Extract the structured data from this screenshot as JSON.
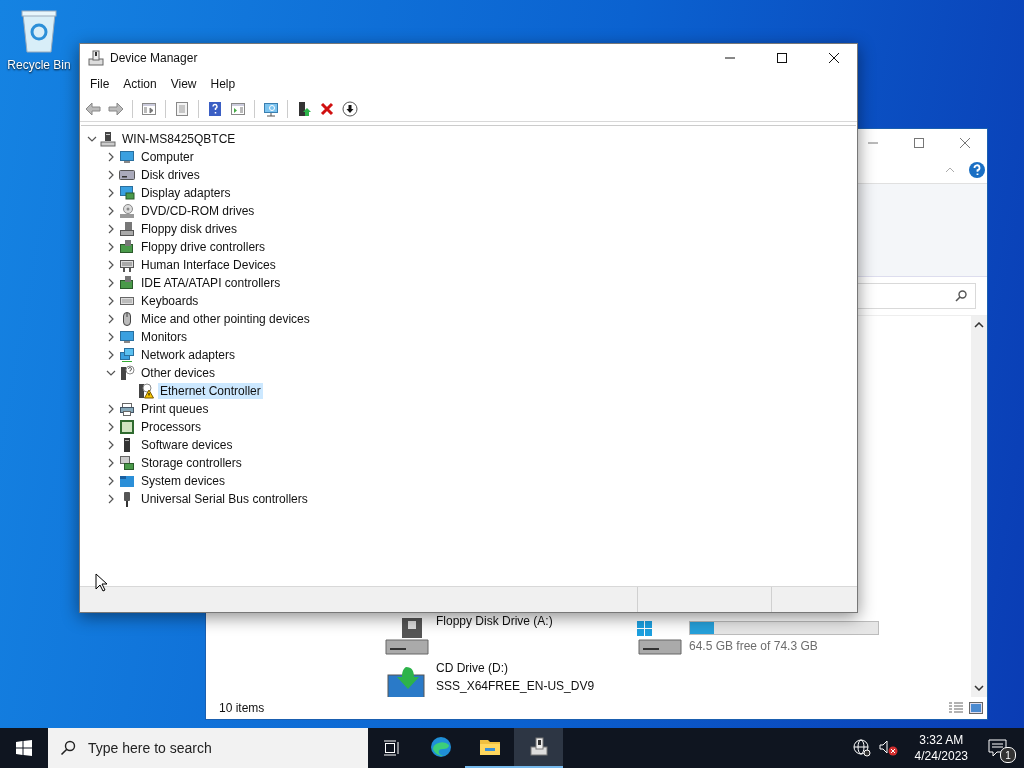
{
  "desktop_icons": [
    {
      "label": "Recycle Bin"
    }
  ],
  "explorer": {
    "items": [
      {
        "kind": "floppy",
        "name": "Floppy Disk Drive (A:)"
      },
      {
        "kind": "disk",
        "level": 0.13,
        "detail": "64.5 GB free of 74.3 GB"
      },
      {
        "kind": "cd",
        "name": "CD Drive (D:)",
        "detail": "SSS_X64FREE_EN-US_DV9"
      }
    ],
    "status": "10 items"
  },
  "window": {
    "title": "Device Manager",
    "menu": [
      "File",
      "Action",
      "View",
      "Help"
    ],
    "tree": {
      "label": "WIN-MS8425QBTCE",
      "expanded": true,
      "selected": false,
      "children": [
        {
          "label": "Computer",
          "expanded": false,
          "selected": false
        },
        {
          "label": "Disk drives",
          "expanded": false,
          "selected": false
        },
        {
          "label": "Display adapters",
          "expanded": false,
          "selected": false
        },
        {
          "label": "DVD/CD-ROM drives",
          "expanded": false,
          "selected": false
        },
        {
          "label": "Floppy disk drives",
          "expanded": false,
          "selected": false
        },
        {
          "label": "Floppy drive controllers",
          "expanded": false,
          "selected": false
        },
        {
          "label": "Human Interface Devices",
          "expanded": false,
          "selected": false
        },
        {
          "label": "IDE ATA/ATAPI controllers",
          "expanded": false,
          "selected": false
        },
        {
          "label": "Keyboards",
          "expanded": false,
          "selected": false
        },
        {
          "label": "Mice and other pointing devices",
          "expanded": false,
          "selected": false
        },
        {
          "label": "Monitors",
          "expanded": false,
          "selected": false
        },
        {
          "label": "Network adapters",
          "expanded": false,
          "selected": false
        },
        {
          "label": "Other devices",
          "expanded": true,
          "selected": false,
          "children": [
            {
              "label": "Ethernet Controller",
              "selected": true
            }
          ]
        },
        {
          "label": "Print queues",
          "expanded": false,
          "selected": false
        },
        {
          "label": "Processors",
          "expanded": false,
          "selected": false
        },
        {
          "label": "Software devices",
          "expanded": false,
          "selected": false
        },
        {
          "label": "Storage controllers",
          "expanded": false,
          "selected": false
        },
        {
          "label": "System devices",
          "expanded": false,
          "selected": false
        },
        {
          "label": "Universal Serial Bus controllers",
          "expanded": false,
          "selected": false
        }
      ]
    }
  },
  "taskbar": {
    "search": {
      "placeholder": "Type here to search"
    },
    "apps": [
      {
        "running": false,
        "selected": false
      },
      {
        "running": true,
        "selected": false
      },
      {
        "running": true,
        "selected": true
      }
    ],
    "time": "3:32 AM",
    "date": "4/24/2023",
    "notifications": "1"
  }
}
